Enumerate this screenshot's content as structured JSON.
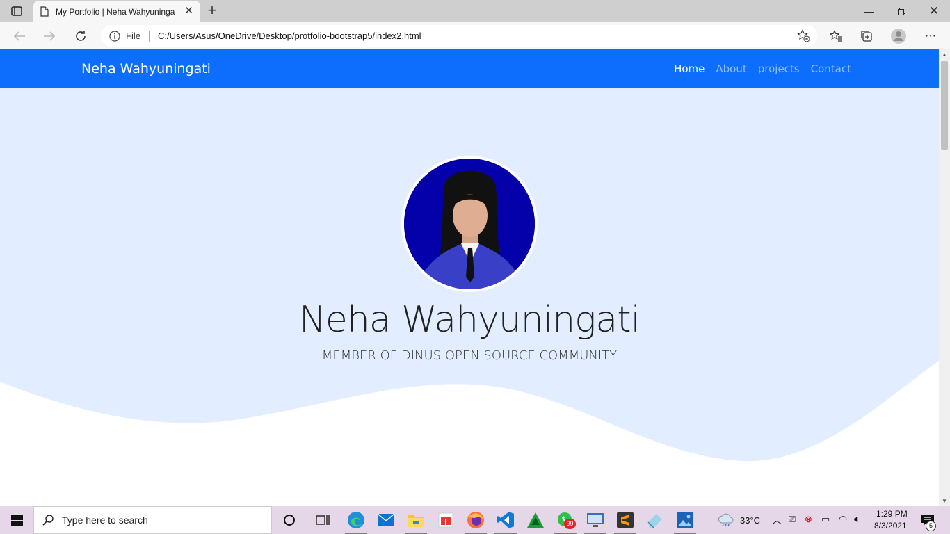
{
  "browser": {
    "tab_title": "My Portfolio | Neha Wahyuningati",
    "address_label": "File",
    "url": "C:/Users/Asus/OneDrive/Desktop/protfolio-bootstrap5/index2.html"
  },
  "page": {
    "brand": "Neha Wahyuningati",
    "nav": [
      {
        "label": "Home",
        "active": true
      },
      {
        "label": "About",
        "active": false
      },
      {
        "label": "projects",
        "active": false
      },
      {
        "label": "Contact",
        "active": false
      }
    ],
    "hero_name": "Neha Wahyuningati",
    "hero_subtitle": "MEMBER OF DINUS OPEN SOURCE COMMUNITY"
  },
  "taskbar": {
    "search_placeholder": "Type here to search",
    "weather": "33°C",
    "time": "1:29 PM",
    "date": "8/3/2021",
    "whatsapp_badge": "99",
    "notification_count": "5"
  },
  "colors": {
    "navbar": "#0d6efd",
    "hero_bg": "#e2edff"
  }
}
